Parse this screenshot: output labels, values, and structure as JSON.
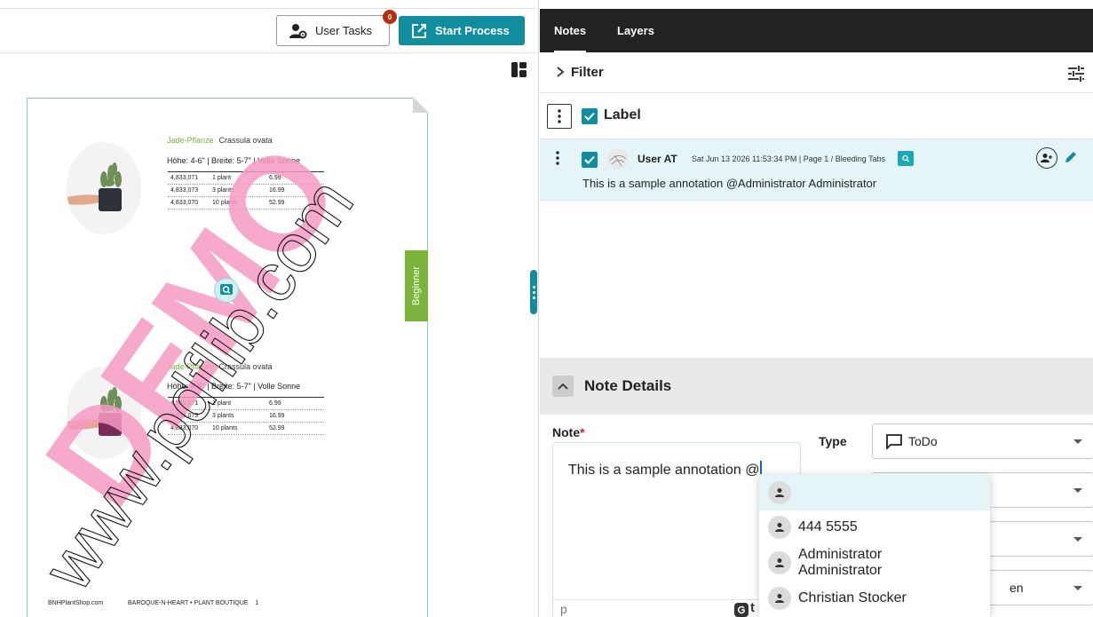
{
  "toolbar": {
    "user_tasks_label": "User Tasks",
    "user_tasks_badge": "0",
    "start_process_label": "Start Process"
  },
  "document": {
    "plants": [
      {
        "name": "Jade-Pflanze",
        "latin": "Crassula ovata",
        "dims": "Höhe: 4-6\" | Breite: 5-7\" | Volle Sonne",
        "rows": [
          {
            "sku": "4,833,071",
            "qty": "1 plant",
            "price": "6.99"
          },
          {
            "sku": "4,833,073",
            "qty": "3 plants",
            "price": "16.99"
          },
          {
            "sku": "4,833,070",
            "qty": "10 plants",
            "price": "52.99"
          }
        ]
      },
      {
        "name": "Jade-Pflanze",
        "latin": "Crassula ovata",
        "dims": "Höhe: 4-6\" | Breite: 5-7\" | Volle Sonne",
        "rows": [
          {
            "sku": "4,833,071",
            "qty": "1 plant",
            "price": "6.99"
          },
          {
            "sku": "4,833,073",
            "qty": "3 plants",
            "price": "16.99"
          },
          {
            "sku": "4,833,070",
            "qty": "10 plants",
            "price": "52.99"
          }
        ]
      }
    ],
    "side_tab": "Beginner",
    "footer_left": "BNHPlantShop.com",
    "footer_center": "BAROQUE-N-HEART • PLANT BOUTIQUE",
    "footer_page": "1",
    "watermark_demo": "DEMO",
    "watermark_url": "www.pdflib.com"
  },
  "panel": {
    "tabs": [
      "Notes",
      "Layers"
    ],
    "filter_label": "Filter",
    "label_header": "Label",
    "note": {
      "author": "User AT",
      "meta": "Sat Jun 13 2026 11:53:34 PM | Page 1 / Bleeding Tabs",
      "text": "This is a sample annotation   @Administrator Administrator"
    },
    "details": {
      "title": "Note Details",
      "note_label": "Note",
      "required_mark": "*",
      "note_value": "This is a sample annotation @",
      "status_p": "p",
      "grammar_t": "t",
      "type_label": "Type",
      "type_value": "ToDo",
      "partial_value": "en"
    }
  },
  "mention_dropdown": {
    "items": [
      "",
      "444 5555",
      "Administrator Administrator",
      "Christian Stocker"
    ]
  }
}
